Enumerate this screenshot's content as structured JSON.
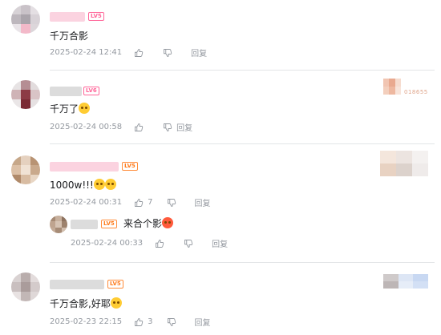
{
  "comments": [
    {
      "text": "千万合影",
      "time": "2025-02-24 12:41",
      "reply_label": "回复"
    },
    {
      "text": "千万了",
      "time": "2025-02-24 00:58",
      "reply_label": "回复",
      "side_label": "018655"
    },
    {
      "text": "1000w!!!",
      "time": "2025-02-24 00:31",
      "likes": "7",
      "reply_label": "回复",
      "sub_reply": {
        "text": "来合个影",
        "time": "2025-02-24 00:33",
        "reply_label": "回复"
      }
    },
    {
      "text": "千万合影,好耶",
      "time": "2025-02-23 22:15",
      "likes": "3",
      "reply_label": "回复"
    }
  ],
  "colors": {
    "level_badge_pink": "#ff6699",
    "level_badge_orange": "#ff7a1a",
    "meta_grey": "#9499a0",
    "divider": "#e3e5e7"
  },
  "icons": [
    "like-icon",
    "dislike-icon",
    "emoji-icon"
  ]
}
